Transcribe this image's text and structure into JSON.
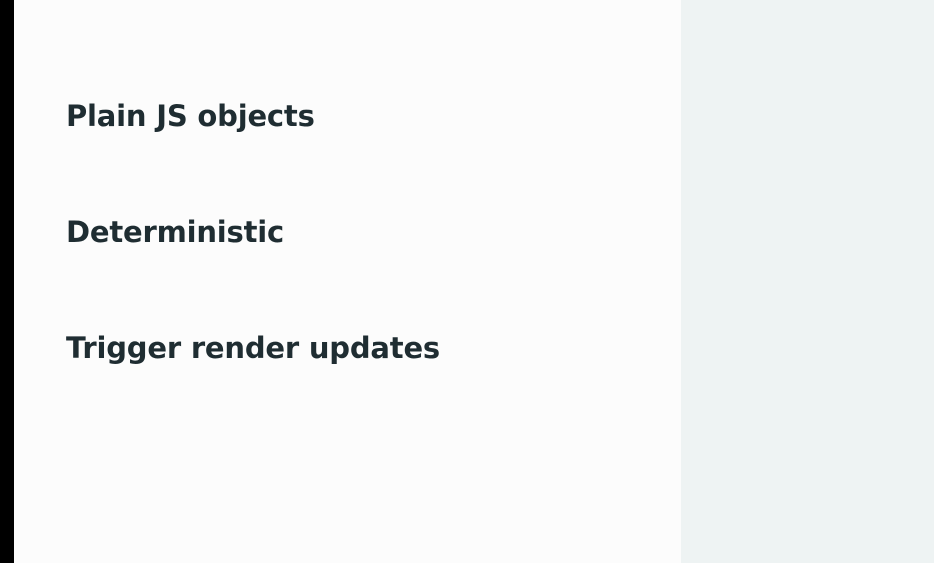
{
  "slide": {
    "points": [
      "Plain JS objects",
      "Deterministic",
      "Trigger render updates"
    ]
  }
}
